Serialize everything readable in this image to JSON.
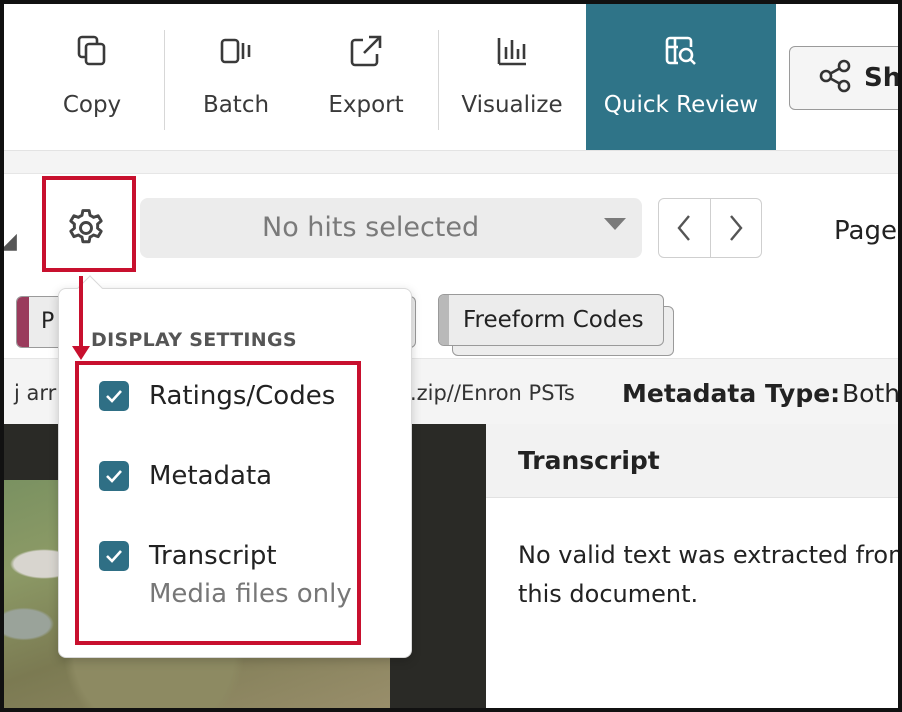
{
  "toolbar": {
    "items": [
      {
        "label": "Copy",
        "icon": "copy-icon"
      },
      {
        "label": "Batch",
        "icon": "batch-icon"
      },
      {
        "label": "Export",
        "icon": "export-icon"
      },
      {
        "label": "Visualize",
        "icon": "bar-chart-icon"
      },
      {
        "label": "Quick Review",
        "icon": "quick-review-icon",
        "active": true
      }
    ],
    "share_label": "Sh",
    "active_color": "#2f7488"
  },
  "hits": {
    "select_value": "No hits selected",
    "page_label": "Page"
  },
  "coding": {
    "tag_p": "P",
    "freeform_label": "Freeform Codes"
  },
  "metadata": {
    "left_text": "j arr",
    "path_text": "s.zip//Enron PSTs",
    "type_label": "Metadata Type:",
    "type_value": "Both"
  },
  "transcript": {
    "header": "Transcript",
    "body": "No valid text was extracted from this document."
  },
  "display_settings": {
    "title": "DISPLAY SETTINGS",
    "options": [
      {
        "label": "Ratings/Codes",
        "checked": true
      },
      {
        "label": "Metadata",
        "checked": true
      },
      {
        "label": "Transcript",
        "checked": true,
        "note": "Media files only"
      }
    ]
  },
  "colors": {
    "highlight": "#c8102e",
    "checkbox": "#2f6f85"
  }
}
